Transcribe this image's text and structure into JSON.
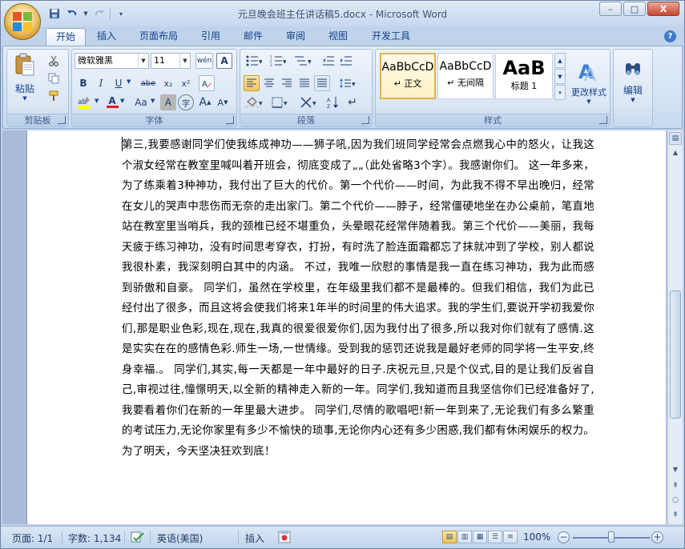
{
  "window": {
    "title": "元旦晚会班主任讲话稿5.docx - Microsoft Word",
    "controls": [
      "–",
      "□",
      "X"
    ]
  },
  "qat": {
    "save_icon": "save-icon",
    "undo_icon": "undo-icon",
    "redo_icon": "redo-icon"
  },
  "tabs": [
    "开始",
    "插入",
    "页面布局",
    "引用",
    "邮件",
    "审阅",
    "视图",
    "开发工具"
  ],
  "ribbon": {
    "clipboard": {
      "label": "剪贴板",
      "paste_label": "粘贴"
    },
    "font": {
      "label": "字体",
      "font_name": "微软雅黑",
      "font_size": "11",
      "wen_button": "wén",
      "bold": "B",
      "italic": "I",
      "underline": "U",
      "strike": "abe",
      "subscript": "x₂",
      "superscript": "x²",
      "font_color": "A",
      "change_case": "Aa",
      "char_shading": "A",
      "enclose": "字",
      "grow": "A",
      "shrink": "A"
    },
    "paragraph": {
      "label": "段落"
    },
    "styles": {
      "label": "样式",
      "items": [
        {
          "sample": "AaBbCcD",
          "name": "↵ 正文"
        },
        {
          "sample": "AaBbCcD",
          "name": "↵ 无间隔"
        },
        {
          "sample": "AaB",
          "name": "标题 1"
        }
      ],
      "change_styles": "更改样式"
    },
    "editing": {
      "label": "编辑"
    }
  },
  "document": {
    "paragraphs": [
      "第三,我要感谢同学们使我练成神功——狮子吼,因为我们班同学经常会点燃我心中的怒火，让我这个淑女经常在教室里喊叫着开班会，彻底变成了„„（此处省略3个字）。我感谢你们。 这一年多来，为了练乘着3种神功，我付出了巨大的代价。第一个代价——时间，为此我不得不早出晚归，经常在女儿的哭声中悲伤而无奈的走出家门。第二个代价——脖子，经常僵硬地坐在办公桌前，笔直地站在教室里当哨兵，我的颈椎已经不堪重负，头晕眼花经常伴随着我。第三个代价——美丽，我每天疲于练习神功，没有时间思考穿衣，打扮，有时洗了脸连面霜都忘了抹就冲到了学校，别人都说我很朴素，我深刻明白其中的内涵。 不过，我唯一欣慰的事情是我一直在练习神功，我为此而感到骄傲和自豪。 同学们，虽然在学校里，在年级里我们都不是最棒的。但我们相信，我们为此已经付出了很多，而且这将会使我们将来1年半的时间里的伟大追求。我的学生们,要说开学初我爱你们,那是职业色彩,现在,现在,我真的很爱很爱你们,因为我付出了很多,所以我对你们就有了感情.这是实实在在的感情色彩.师生一场,一世情缘。受到我的惩罚还说我是最好老师的同学将一生平安,终身幸福.。 同学们,其实,每一天都是一年中最好的日子.庆祝元旦,只是个仪式,目的是让我们反省自己,审视过往,憧憬明天,以全新的精神走入新的一年。同学们,我知道而且我坚信你们已经准备好了,我要看着你们在新的一年里最大进步。 同学们,尽情的歌唱吧!新一年到来了,无论我们有多么繁重的考试压力,无论你家里有多少不愉快的琐事,无论你内心还有多少困惑,我们都有休闲娱乐的权力。为了明天，今天坚决狂欢到底！"
    ]
  },
  "statusbar": {
    "page": "页面: 1/1",
    "words": "字数: 1,134",
    "language": "英语(美国)",
    "insert": "插入",
    "zoom": "100%"
  }
}
